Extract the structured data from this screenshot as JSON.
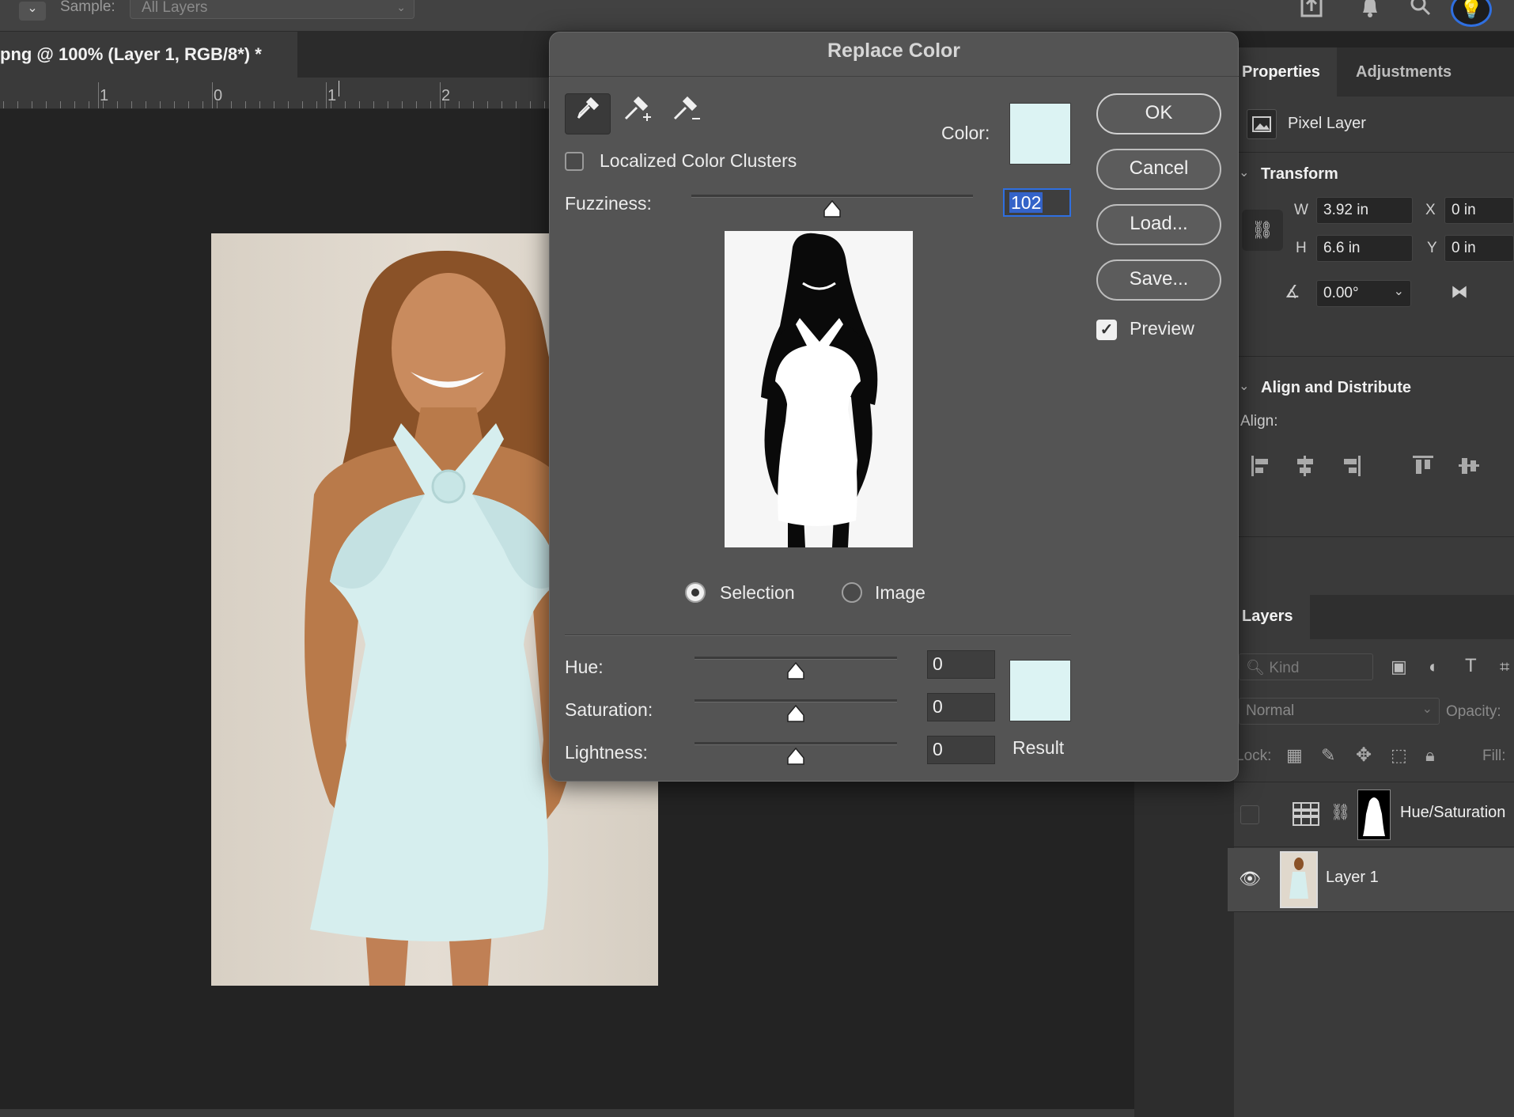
{
  "optionsBar": {
    "sample_label": "Sample:",
    "sample_value": "All Layers"
  },
  "document": {
    "tab_title": "png @ 100% (Layer 1, RGB/8*) *",
    "ruler_labels": [
      "1",
      "0",
      "1",
      "2"
    ]
  },
  "dialog": {
    "title": "Replace Color",
    "localized_label": "Localized Color Clusters",
    "localized_checked": false,
    "color_label": "Color:",
    "color_swatch": "#dcf3f3",
    "fuzziness_label": "Fuzziness:",
    "fuzziness_value": "102",
    "fuzziness_level": 0.5,
    "buttons": {
      "ok": "OK",
      "cancel": "Cancel",
      "load": "Load...",
      "save": "Save..."
    },
    "preview_label": "Preview",
    "preview_checked": true,
    "mode_selection": "Selection",
    "mode_image": "Image",
    "mode_selected": "Selection",
    "hue_label": "Hue:",
    "hue_value": "0",
    "saturation_label": "Saturation:",
    "saturation_value": "0",
    "lightness_label": "Lightness:",
    "lightness_value": "0",
    "result_label": "Result",
    "result_swatch": "#dcf3f3"
  },
  "properties": {
    "tab_properties": "Properties",
    "tab_adjustments": "Adjustments",
    "pixel_layer_label": "Pixel Layer",
    "transform_title": "Transform",
    "w_label": "W",
    "w_value": "3.92 in",
    "x_label": "X",
    "x_value": "0 in",
    "h_label": "H",
    "h_value": "6.6 in",
    "y_label": "Y",
    "y_value": "0 in",
    "angle_value": "0.00°",
    "align_title": "Align and Distribute",
    "align_label": "Align:"
  },
  "layers": {
    "tab_label": "Layers",
    "kind_placeholder": "Kind",
    "blend_mode": "Normal",
    "opacity_label": "Opacity:",
    "lock_label": "Lock:",
    "fill_label": "Fill:",
    "items": [
      {
        "name": "Hue/Saturation",
        "visible": false
      },
      {
        "name": "Layer 1",
        "visible": true
      }
    ]
  },
  "colors": {
    "accent": "#2f6fe0",
    "dialog_bg": "#545454",
    "dress": "#d6eeee"
  }
}
